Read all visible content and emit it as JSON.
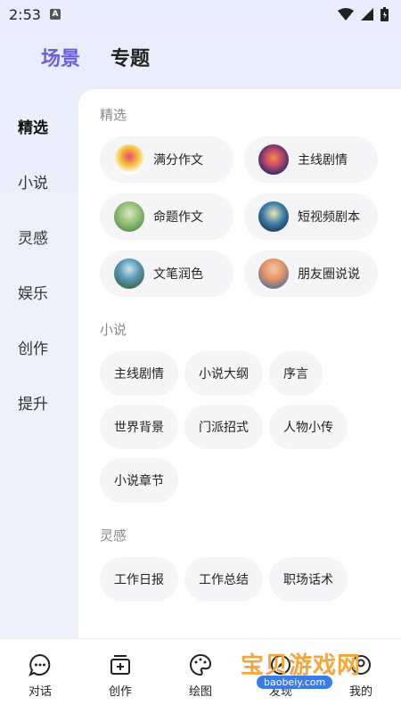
{
  "status_bar": {
    "time": "2:53",
    "notification_badge": "A"
  },
  "top_tabs": [
    {
      "label": "场景",
      "active": true
    },
    {
      "label": "专题",
      "active": false
    }
  ],
  "side_nav": [
    {
      "label": "精选",
      "active": true
    },
    {
      "label": "小说",
      "active": false
    },
    {
      "label": "灵感",
      "active": false
    },
    {
      "label": "娱乐",
      "active": false
    },
    {
      "label": "创作",
      "active": false
    },
    {
      "label": "提升",
      "active": false
    }
  ],
  "sections": {
    "featured": {
      "title": "精选",
      "cards": [
        {
          "label": "满分作文"
        },
        {
          "label": "主线剧情"
        },
        {
          "label": "命题作文"
        },
        {
          "label": "短视频剧本"
        },
        {
          "label": "文笔润色"
        },
        {
          "label": "朋友圈说说"
        }
      ]
    },
    "novel": {
      "title": "小说",
      "chips": [
        "主线剧情",
        "小说大纲",
        "序言",
        "世界背景",
        "门派招式",
        "人物小传",
        "小说章节"
      ]
    },
    "inspiration": {
      "title": "灵感",
      "chips": [
        "工作日报",
        "工作总结",
        "职场话术"
      ]
    }
  },
  "bottom_nav": [
    {
      "label": "对话",
      "icon": "chat-icon"
    },
    {
      "label": "创作",
      "icon": "create-icon"
    },
    {
      "label": "绘图",
      "icon": "palette-icon"
    },
    {
      "label": "发现",
      "icon": "discover-icon"
    },
    {
      "label": "我的",
      "icon": "profile-icon"
    }
  ],
  "watermark": {
    "text": "宝贝游戏网",
    "url": "baobeiy.com"
  },
  "colors": {
    "accent": "#6c5ce7",
    "chip_bg": "#f5f5f7"
  }
}
